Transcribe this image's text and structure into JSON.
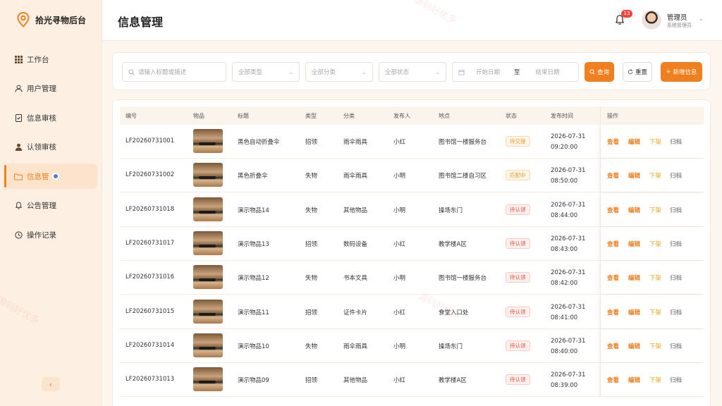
{
  "app": {
    "name": "拾光寻物后台"
  },
  "sidebar": {
    "items": [
      {
        "label": "工作台",
        "icon": "grid-icon",
        "active": false
      },
      {
        "label": "用户管理",
        "icon": "user-icon",
        "active": false
      },
      {
        "label": "信息审核",
        "icon": "document-check-icon",
        "active": false
      },
      {
        "label": "认领审核",
        "icon": "person-icon",
        "active": false
      },
      {
        "label": "信息管",
        "icon": "folder-icon",
        "active": true
      },
      {
        "label": "公告管理",
        "icon": "bell-icon",
        "active": false
      },
      {
        "label": "操作记录",
        "icon": "clock-icon",
        "active": false
      }
    ],
    "collapse_label": "‹"
  },
  "header": {
    "title": "信息管理",
    "notification_count": "13",
    "user_name": "管理员",
    "user_role": "系统管理员"
  },
  "filters": {
    "search_placeholder": "请输入标题或描述",
    "type_placeholder": "全部类型",
    "category_placeholder": "全部分类",
    "status_placeholder": "全部状态",
    "start_date_placeholder": "开始日期",
    "date_separator": "至",
    "end_date_placeholder": "结束日期",
    "query_label": "查询",
    "reset_label": "重置",
    "add_label": "新增信息"
  },
  "table": {
    "columns": [
      "编号",
      "物品",
      "标题",
      "类型",
      "分类",
      "发布人",
      "地点",
      "状态",
      "发布时间",
      "操作"
    ],
    "actions": {
      "view": "查看",
      "edit": "编辑",
      "down": "下架",
      "archive": "归档"
    },
    "rows": [
      {
        "id": "LF20260731001",
        "title": "黑色自动折叠伞",
        "type": "招领",
        "category": "雨伞雨具",
        "publisher": "小红",
        "location": "图书馆一楼服务台",
        "status": "待交接",
        "status_color": "orange",
        "date": "2026-07-31",
        "time": "09:20:00"
      },
      {
        "id": "LF20260731002",
        "title": "黑色折叠伞",
        "type": "失物",
        "category": "雨伞雨具",
        "publisher": "小明",
        "location": "图书馆二楼自习区",
        "status": "匹配中",
        "status_color": "orange",
        "date": "2026-07-31",
        "time": "08:50:00"
      },
      {
        "id": "LF20260731018",
        "title": "演示物品14",
        "type": "失物",
        "category": "其他物品",
        "publisher": "小明",
        "location": "操场东门",
        "status": "待认领",
        "status_color": "red",
        "date": "2026-07-31",
        "time": "08:44:00"
      },
      {
        "id": "LF20260731017",
        "title": "演示物品13",
        "type": "招领",
        "category": "数码设备",
        "publisher": "小红",
        "location": "教学楼A区",
        "status": "待认领",
        "status_color": "red",
        "date": "2026-07-31",
        "time": "08:43:00"
      },
      {
        "id": "LF20260731016",
        "title": "演示物品12",
        "type": "失物",
        "category": "书本文具",
        "publisher": "小明",
        "location": "图书馆一楼服务台",
        "status": "待认领",
        "status_color": "red",
        "date": "2026-07-31",
        "time": "08:42:00"
      },
      {
        "id": "LF20260731015",
        "title": "演示物品11",
        "type": "招领",
        "category": "证件卡片",
        "publisher": "小红",
        "location": "食堂入口处",
        "status": "待认领",
        "status_color": "red",
        "date": "2026-07-31",
        "time": "08:41:00"
      },
      {
        "id": "LF20260731014",
        "title": "演示物品10",
        "type": "失物",
        "category": "雨伞雨具",
        "publisher": "小明",
        "location": "操场东门",
        "status": "待认领",
        "status_color": "red",
        "date": "2026-07-31",
        "time": "08:40:00"
      },
      {
        "id": "LF20260731013",
        "title": "演示物品09",
        "type": "招领",
        "category": "其他物品",
        "publisher": "小红",
        "location": "教学楼A区",
        "status": "待认领",
        "status_color": "red",
        "date": "2026-07-31",
        "time": "08:39:00"
      }
    ]
  },
  "watermarks": [
    "源码好优多",
    "源码好优多",
    "源码好优多"
  ],
  "colors": {
    "accent": "#f07f1e",
    "sidebar_bg": "#fdf0e3",
    "badge": "#f2453d"
  }
}
